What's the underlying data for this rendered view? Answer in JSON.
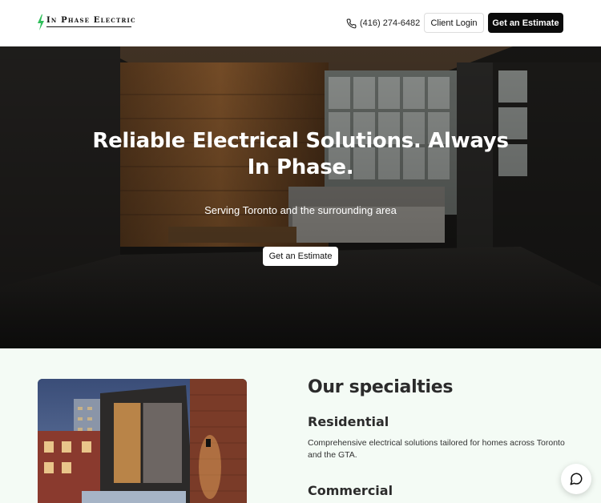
{
  "brand": {
    "name": "In Phase Electric",
    "accent_color": "#2fbf5a"
  },
  "header": {
    "phone": "(416) 274-6482",
    "phone_icon": "phone-icon",
    "client_login_label": "Client Login",
    "estimate_label": "Get an Estimate"
  },
  "hero": {
    "title": "Reliable Electrical Solutions. Always In Phase.",
    "subtitle": "Serving Toronto and the surrounding area",
    "cta_label": "Get an Estimate"
  },
  "specialties": {
    "title": "Our specialties",
    "items": [
      {
        "heading": "Residential",
        "description": "Comprehensive electrical solutions tailored for homes across Toronto and the GTA."
      },
      {
        "heading": "Commercial",
        "description": ""
      }
    ]
  },
  "chat": {
    "icon": "chat-bubble-icon"
  }
}
